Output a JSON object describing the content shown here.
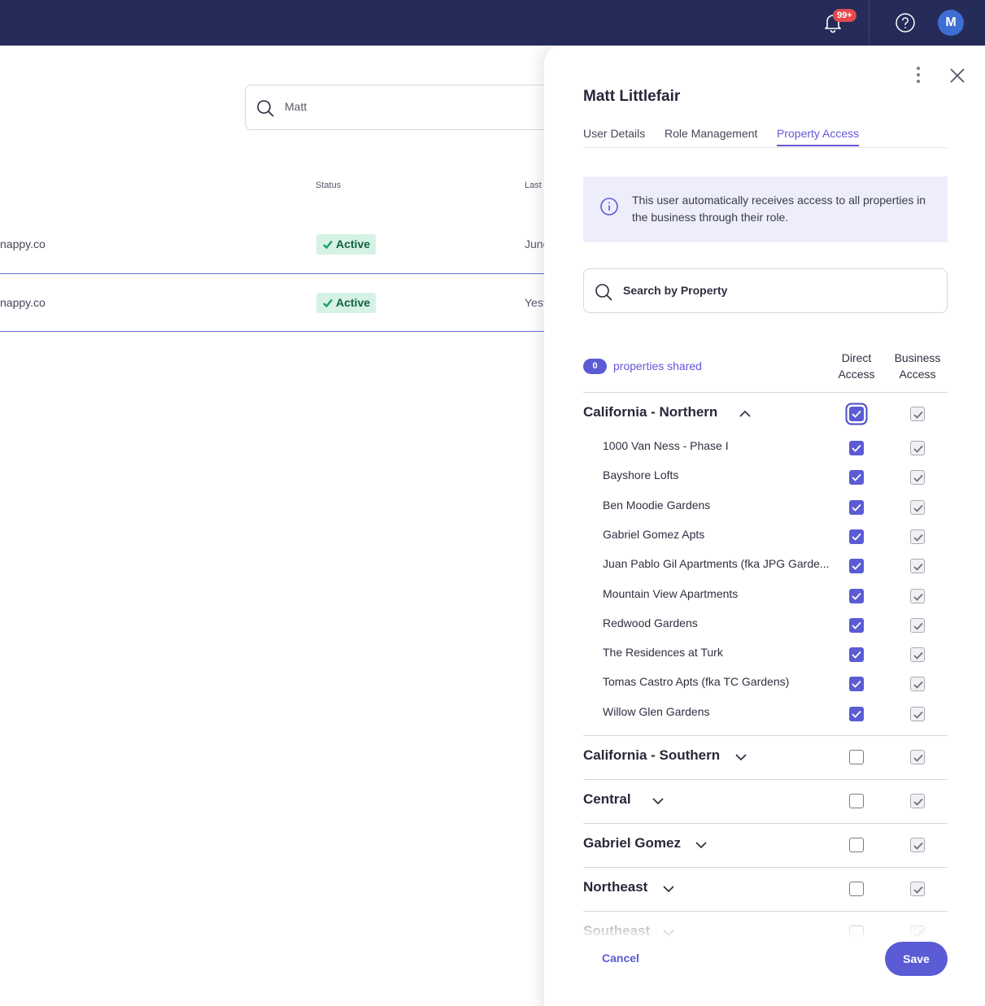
{
  "header": {
    "notification_count": "99+",
    "avatar_initial": "M"
  },
  "background": {
    "search": {
      "value": "Matt"
    },
    "columns": {
      "status": "Status",
      "last": "Last"
    },
    "rows": [
      {
        "email": "nappy.co",
        "status": "Active",
        "last": "June"
      },
      {
        "email": "nappy.co",
        "status": "Active",
        "last": "Yest"
      }
    ]
  },
  "panel": {
    "title": "Matt Littlefair",
    "tabs": [
      "User Details",
      "Role Management",
      "Property Access"
    ],
    "active_tab": "Property Access",
    "info_text": "This user automatically receives access to all properties in the business through their role.",
    "search_placeholder": "Search by Property",
    "shared_count": "0",
    "shared_label": "properties shared",
    "col_direct": "Direct Access",
    "col_business": "Business Access",
    "groups": [
      {
        "name": "California - Northern",
        "expanded": true,
        "direct": true,
        "business": true,
        "properties": [
          {
            "name": "1000 Van Ness - Phase I",
            "direct": true,
            "business": true
          },
          {
            "name": "Bayshore Lofts",
            "direct": true,
            "business": true
          },
          {
            "name": "Ben Moodie Gardens",
            "direct": true,
            "business": true
          },
          {
            "name": "Gabriel Gomez Apts",
            "direct": true,
            "business": true
          },
          {
            "name": "Juan Pablo Gil Apartments (fka JPG Garde...",
            "direct": true,
            "business": true
          },
          {
            "name": "Mountain View Apartments",
            "direct": true,
            "business": true
          },
          {
            "name": "Redwood Gardens",
            "direct": true,
            "business": true
          },
          {
            "name": "The Residences at Turk",
            "direct": true,
            "business": true
          },
          {
            "name": "Tomas Castro Apts (fka TC Gardens)",
            "direct": true,
            "business": true
          },
          {
            "name": "Willow Glen Gardens",
            "direct": true,
            "business": true
          }
        ]
      },
      {
        "name": "California - Southern",
        "expanded": false,
        "direct": false,
        "business": true
      },
      {
        "name": "Central",
        "expanded": false,
        "direct": false,
        "business": true
      },
      {
        "name": "Gabriel Gomez",
        "expanded": false,
        "direct": false,
        "business": true
      },
      {
        "name": "Northeast",
        "expanded": false,
        "direct": false,
        "business": true
      },
      {
        "name": "Southeast",
        "expanded": false,
        "direct": false,
        "business": true
      }
    ],
    "cancel_label": "Cancel",
    "save_label": "Save"
  },
  "colors": {
    "topbar": "#252c5a",
    "accent": "#5b5bd6",
    "status_bg": "#d5f2e5",
    "status_text": "#10603d",
    "badge": "#e5484d"
  }
}
